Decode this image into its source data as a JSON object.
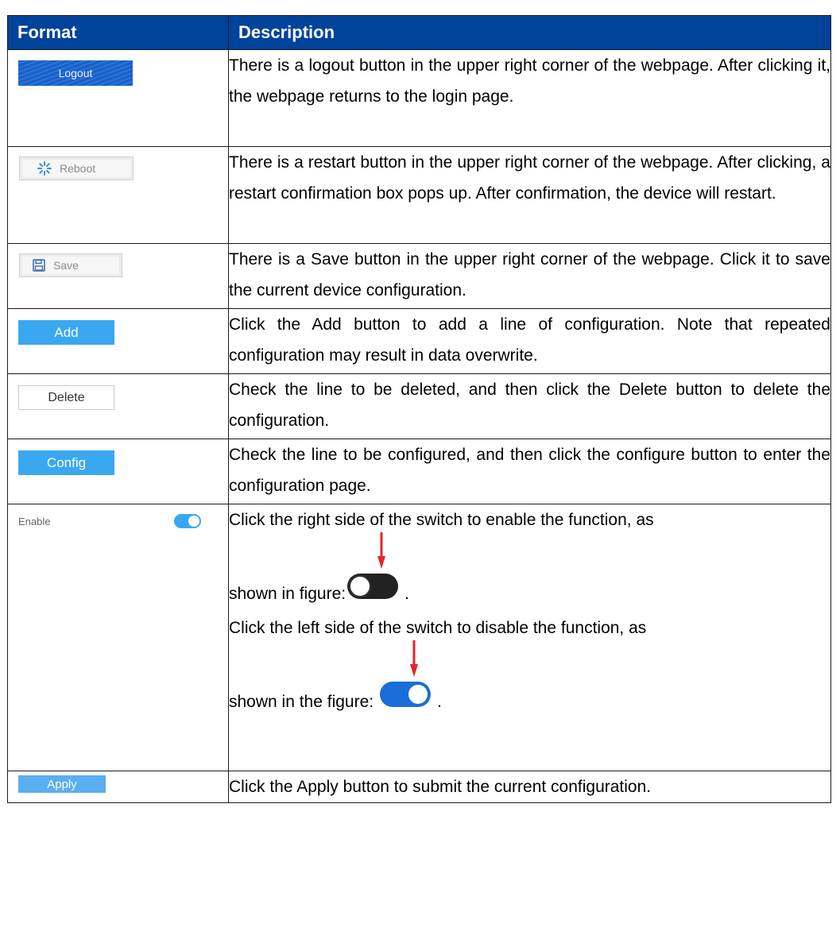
{
  "header": {
    "format": "Format",
    "description": "Description"
  },
  "rows": [
    {
      "button_label": "Logout",
      "description": "There is a logout button in the upper right corner of the webpage. After clicking it, the webpage returns to the login page."
    },
    {
      "button_label": "Reboot",
      "description": "There is a restart button in the upper right corner of the webpage. After clicking, a restart confirmation box pops up. After confirmation, the device will restart."
    },
    {
      "button_label": "Save",
      "description": "There is a Save button in the upper right corner of the webpage. Click it to save the current device configuration."
    },
    {
      "button_label": "Add",
      "description": "Click the Add button to add a line of configuration. Note that repeated configuration may result in data overwrite."
    },
    {
      "button_label": "Delete",
      "description": "Check the line to be deleted, and then click the Delete button to delete the configuration."
    },
    {
      "button_label": "Config",
      "description": "Check the line to be configured, and then click the configure button to enter the configuration page."
    },
    {
      "button_label": "Enable",
      "desc_enable_1": "Click the right side of the switch to enable the function, as",
      "desc_enable_2": "shown in figure:",
      "desc_disable_1": "Click the left side of the switch to disable the function, as",
      "desc_disable_2": "shown in the figure:",
      "period": "."
    },
    {
      "button_label": "Apply",
      "description": "Click the Apply button to submit the current configuration."
    }
  ],
  "colors": {
    "header_bg": "#00439b",
    "button_blue": "#3aa8f0",
    "arrow_red": "#e3242b"
  }
}
